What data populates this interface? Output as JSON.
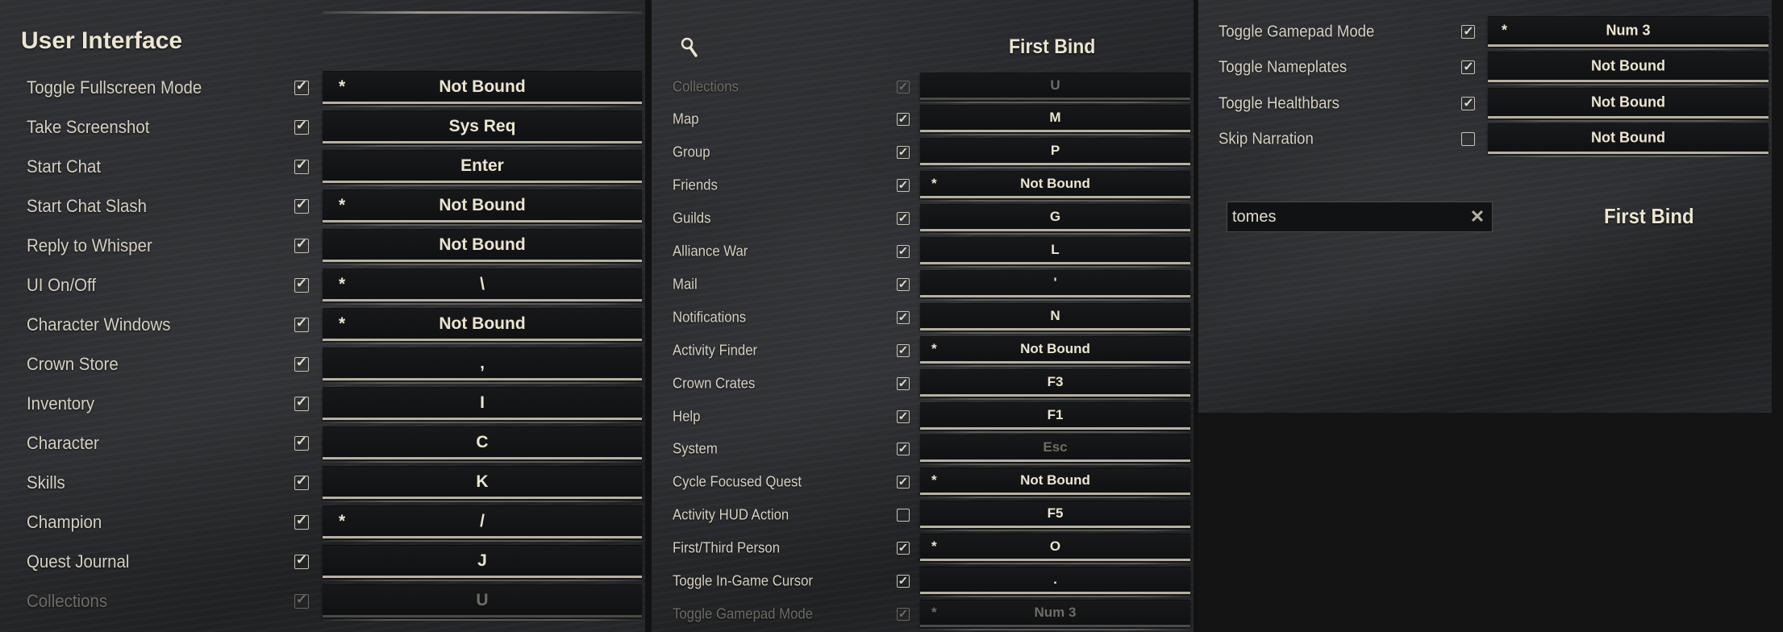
{
  "colors": {
    "text": "#d6d0c0",
    "header": "#ece5d0",
    "dimmed": "#6f6c66",
    "bind_bg": "#141517",
    "bind_border": "#b7b1a1"
  },
  "icons": {
    "checkbox_checked": "checkmark-icon",
    "search": "magnifier-icon",
    "clear": "x-icon"
  },
  "panel_left": {
    "title": "User Interface",
    "rows": [
      {
        "action": "Toggle Fullscreen Mode",
        "checked": true,
        "star": "*",
        "bind": "Not Bound"
      },
      {
        "action": "Take Screenshot",
        "checked": true,
        "star": "",
        "bind": "Sys Req"
      },
      {
        "action": "Start Chat",
        "checked": true,
        "star": "",
        "bind": "Enter"
      },
      {
        "action": "Start Chat Slash",
        "checked": true,
        "star": "*",
        "bind": "Not Bound"
      },
      {
        "action": "Reply to Whisper",
        "checked": true,
        "star": "",
        "bind": "Not Bound"
      },
      {
        "action": "UI On/Off",
        "checked": true,
        "star": "*",
        "bind": "\\"
      },
      {
        "action": "Character Windows",
        "checked": true,
        "star": "*",
        "bind": "Not Bound"
      },
      {
        "action": "Crown Store",
        "checked": true,
        "star": "",
        "bind": ","
      },
      {
        "action": "Inventory",
        "checked": true,
        "star": "",
        "bind": "I"
      },
      {
        "action": "Character",
        "checked": true,
        "star": "",
        "bind": "C"
      },
      {
        "action": "Skills",
        "checked": true,
        "star": "",
        "bind": "K"
      },
      {
        "action": "Champion",
        "checked": true,
        "star": "*",
        "bind": "/"
      },
      {
        "action": "Quest Journal",
        "checked": true,
        "star": "",
        "bind": "J"
      },
      {
        "action": "Collections",
        "checked": true,
        "star": "",
        "bind": "U",
        "dimmed": true
      }
    ]
  },
  "panel_middle": {
    "column_header": "First Bind",
    "rows": [
      {
        "action": "Collections",
        "checked": true,
        "star": "",
        "bind": "U",
        "dimmed": true
      },
      {
        "action": "Map",
        "checked": true,
        "star": "",
        "bind": "M"
      },
      {
        "action": "Group",
        "checked": true,
        "star": "",
        "bind": "P"
      },
      {
        "action": "Friends",
        "checked": true,
        "star": "*",
        "bind": "Not Bound"
      },
      {
        "action": "Guilds",
        "checked": true,
        "star": "",
        "bind": "G"
      },
      {
        "action": "Alliance War",
        "checked": true,
        "star": "",
        "bind": "L"
      },
      {
        "action": "Mail",
        "checked": true,
        "star": "",
        "bind": "'"
      },
      {
        "action": "Notifications",
        "checked": true,
        "star": "",
        "bind": "N"
      },
      {
        "action": "Activity Finder",
        "checked": true,
        "star": "*",
        "bind": "Not Bound"
      },
      {
        "action": "Crown Crates",
        "checked": true,
        "star": "",
        "bind": "F3"
      },
      {
        "action": "Help",
        "checked": true,
        "star": "",
        "bind": "F1"
      },
      {
        "action": "System",
        "checked": true,
        "star": "",
        "bind": "Esc",
        "bind_dimmed": true
      },
      {
        "action": "Cycle Focused Quest",
        "checked": true,
        "star": "*",
        "bind": "Not Bound"
      },
      {
        "action": "Activity HUD Action",
        "checked": false,
        "star": "",
        "bind": "F5"
      },
      {
        "action": "First/Third Person",
        "checked": true,
        "star": "*",
        "bind": "O"
      },
      {
        "action": "Toggle In-Game Cursor",
        "checked": true,
        "star": "",
        "bind": "."
      },
      {
        "action": "Toggle Gamepad Mode",
        "checked": true,
        "star": "*",
        "bind": "Num 3",
        "dimmed": true
      }
    ]
  },
  "panel_right": {
    "rows": [
      {
        "action": "Toggle Gamepad Mode",
        "checked": true,
        "star": "*",
        "bind": "Num 3"
      },
      {
        "action": "Toggle Nameplates",
        "checked": true,
        "star": "",
        "bind": "Not Bound"
      },
      {
        "action": "Toggle Healthbars",
        "checked": true,
        "star": "",
        "bind": "Not Bound"
      },
      {
        "action": "Skip Narration",
        "checked": false,
        "star": "",
        "bind": "Not Bound"
      }
    ],
    "search": {
      "value": "tomes",
      "placeholder": ""
    },
    "column_header": "First Bind"
  }
}
